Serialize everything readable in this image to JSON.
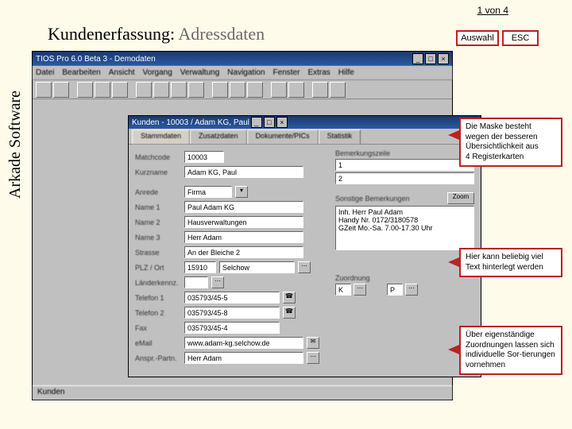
{
  "pageCounter": "1 von 4",
  "header": {
    "black": "Kundenerfassung:",
    "gray": "Adressdaten"
  },
  "nav": {
    "auswahl": "Auswahl",
    "esc": "ESC"
  },
  "brand": "Arkade Software",
  "appTitle": "TIOS Pro 6.0 Beta 3 - Demodaten",
  "menu": [
    "Datei",
    "Bearbeiten",
    "Ansicht",
    "Vorgang",
    "Verwaltung",
    "Navigation",
    "Fenster",
    "Extras",
    "Hilfe"
  ],
  "subTitle": "Kunden - 10003 / Adam KG, Paul",
  "tabs": [
    "Stammdaten",
    "Zusatzdaten",
    "Dokumente/PICs",
    "Statistik"
  ],
  "labels": {
    "matchcode": "Matchcode",
    "kurzname": "Kurzname",
    "anrede": "Anrede",
    "name1": "Name 1",
    "name2": "Name 2",
    "name3": "Name 3",
    "strasse": "Strasse",
    "plzort": "PLZ / Ort",
    "laenderkz": "Länderkennz.",
    "telefon1": "Telefon 1",
    "telefon2": "Telefon 2",
    "fax": "Fax",
    "email": "eMail",
    "ansprech": "Anspr.-Partn.",
    "bemerkung": "Bemerkungszeile",
    "sonstige": "Sonstige Bemerkungen",
    "zoom": "Zoom",
    "zuordnung": "Zuordnung"
  },
  "values": {
    "matchcode": "10003",
    "kurzname": "Adam KG, Paul",
    "anrede": "Firma",
    "name1": "Paul Adam KG",
    "name2": "Hausverwaltungen",
    "name3": "Herr Adam",
    "strasse": "An der Bleiche 2",
    "plz": "15910",
    "ort": "Selchow",
    "laenderkz": "",
    "telefon1": "035793/45-5",
    "telefon2": "035793/45-8",
    "fax": "035793/45-4",
    "email": "www.adam-kg.selchow.de",
    "ansprech": "Herr Adam",
    "bem1": "1",
    "bem2": "2",
    "sonstigeText": "Inh. Herr Paul Adam\nHandy Nr. 0172/3180578\nGZeit Mo.-Sa. 7.00-17.30 Uhr",
    "zuordK": "K",
    "zuordP": "P"
  },
  "callouts": {
    "c1": "Die Maske besteht wegen der besseren Übersichtlichkeit aus\n4 Registerkarten",
    "c2": "Hier kann beliebig viel Text hinterlegt werden",
    "c3": "Über eigenständige Zuordnungen lassen sich individuelle Sor-tierungen vornehmen"
  },
  "statusBar": "Kunden"
}
